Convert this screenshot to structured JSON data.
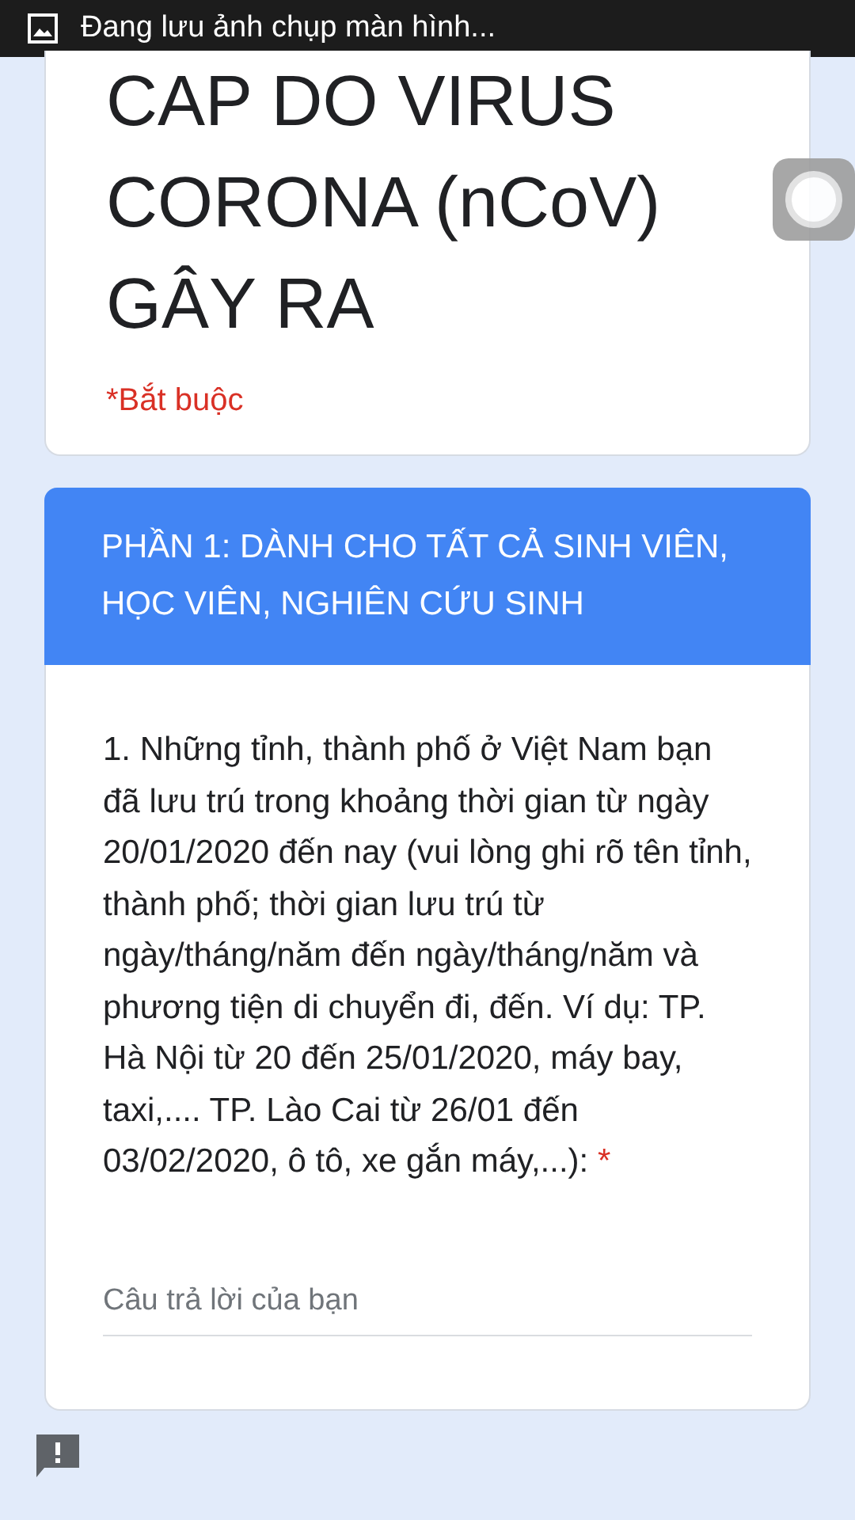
{
  "status_bar": {
    "text": "Đang lưu ảnh chụp màn hình..."
  },
  "form": {
    "title": "CAP DO VIRUS CORONA (nCoV) GÂY RA",
    "required_note": "*Bắt buộc"
  },
  "section": {
    "title": "PHẦN 1: DÀNH CHO TẤT CẢ SINH VIÊN, HỌC VIÊN, NGHIÊN CỨU SINH"
  },
  "questions": [
    {
      "text": "1. Những tỉnh, thành phố ở Việt Nam bạn đã lưu trú trong khoảng thời gian từ ngày 20/01/2020 đến nay (vui lòng ghi rõ tên tỉnh, thành phố; thời gian lưu trú từ ngày/tháng/năm đến ngày/tháng/năm và phương tiện di chuyển đi, đến. Ví dụ: TP. Hà Nội từ 20 đến 25/01/2020, máy bay, taxi,.... TP. Lào Cai từ 26/01 đến 03/02/2020, ô tô, xe gắn máy,...):",
      "required_mark": "*",
      "placeholder": "Câu trả lời của bạn"
    }
  ]
}
